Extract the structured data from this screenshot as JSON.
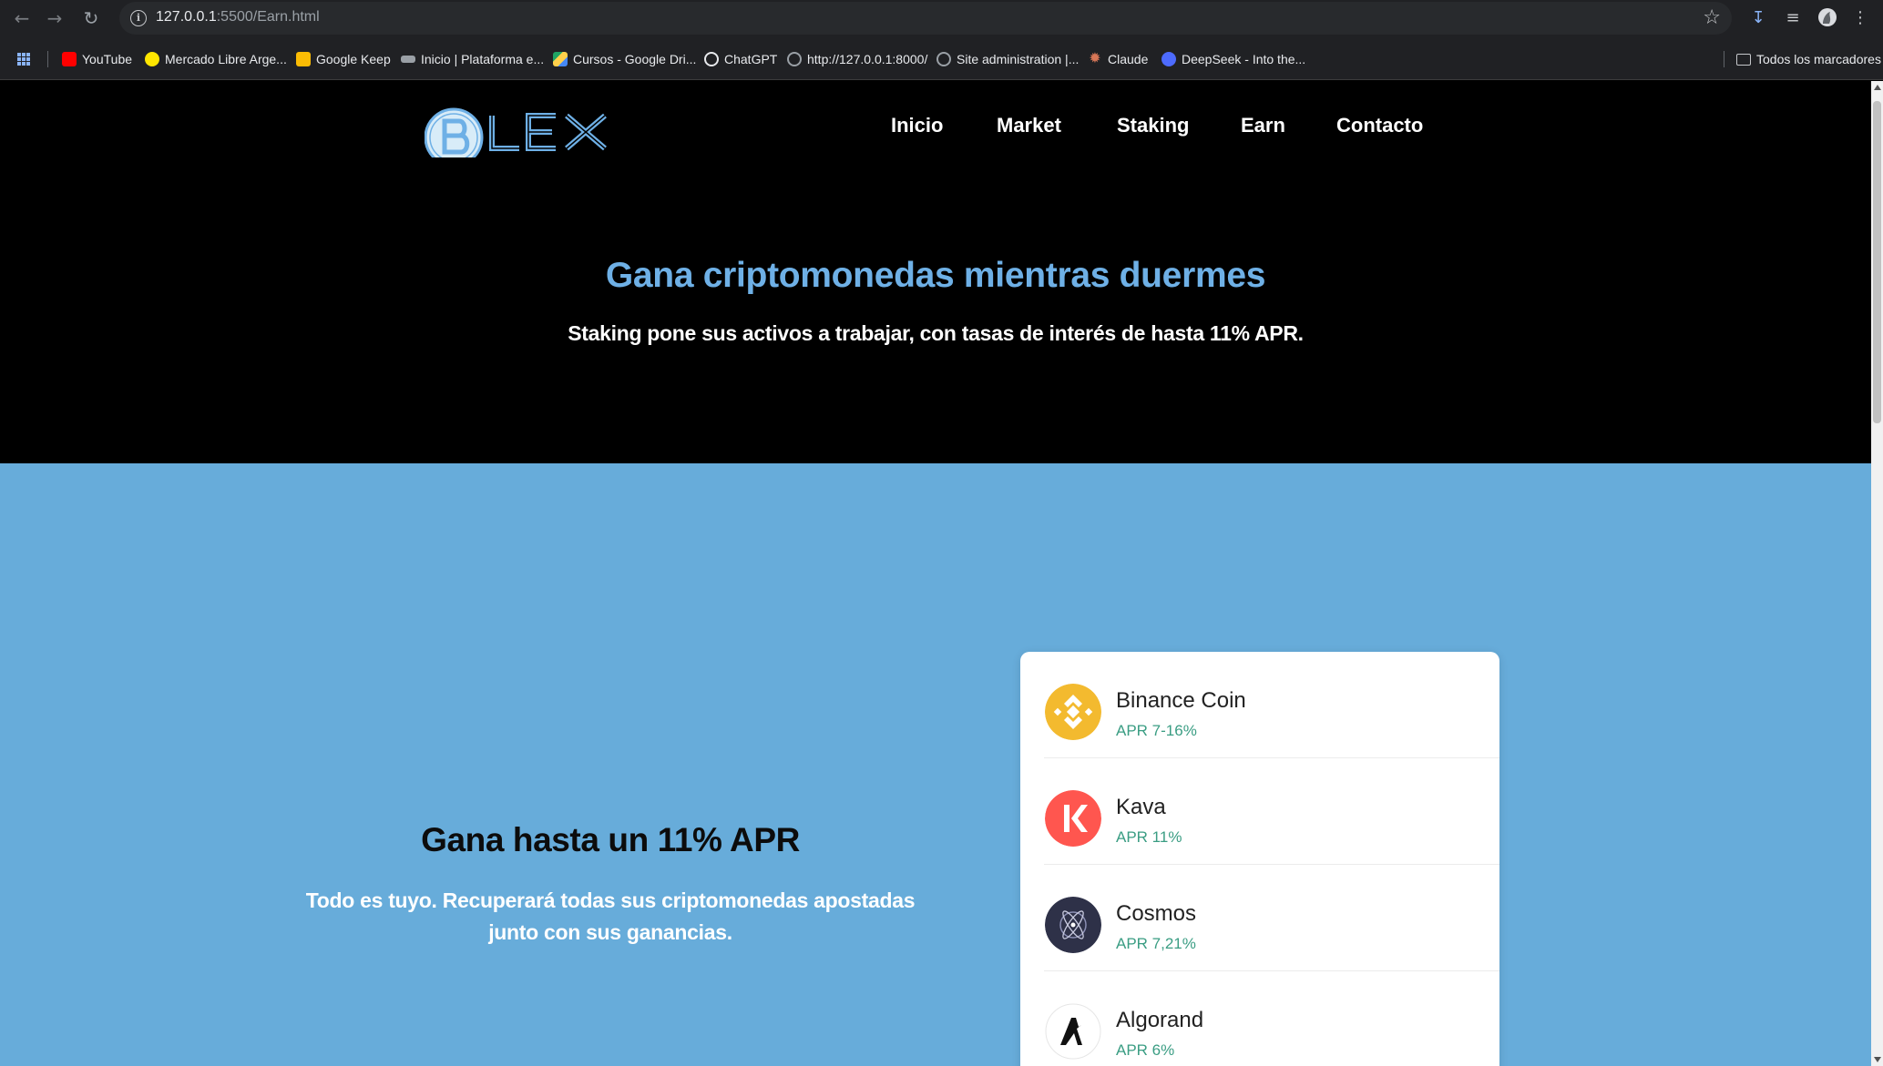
{
  "browser": {
    "url_host": "127.0.0.1",
    "url_rest": ":5500/Earn.html",
    "bookmarks": [
      {
        "label": "YouTube",
        "color": "#ff0000"
      },
      {
        "label": "Mercado Libre Arge...",
        "color": "#ffe600"
      },
      {
        "label": "Google Keep",
        "color": "#fbbc04"
      },
      {
        "label": "Inicio | Plataforma e...",
        "color": "#9aa0a6"
      },
      {
        "label": "Cursos - Google Dri...",
        "color": "#1fa463"
      },
      {
        "label": "ChatGPT",
        "color": "#e8eaed"
      },
      {
        "label": "http://127.0.0.1:8000/",
        "color": "#9aa0a6"
      },
      {
        "label": "Site administration |...",
        "color": "#9aa0a6"
      },
      {
        "label": "Claude",
        "color": "#d97757"
      },
      {
        "label": "DeepSeek - Into the...",
        "color": "#4d6bfe"
      }
    ],
    "all_bookmarks": "Todos los marcadores"
  },
  "nav": {
    "items": [
      "Inicio",
      "Market",
      "Staking",
      "Earn",
      "Contacto"
    ]
  },
  "logo": {
    "text": "BLEX",
    "color": "#6eb0e6"
  },
  "hero": {
    "title": "Gana criptomonedas mientras duermes",
    "subtitle": "Staking pone sus activos a trabajar, con tasas de interés de hasta 11% APR."
  },
  "section": {
    "title": "Gana hasta un 11% APR",
    "text": "Todo es tuyo. Recuperará todas sus criptomonedas apostadas junto con sus ganancias."
  },
  "coins": [
    {
      "name": "Binance Coin",
      "apr": "APR 7-16%",
      "icon": "binance-icon",
      "color": "#f3ba2f"
    },
    {
      "name": "Kava",
      "apr": "APR 11%",
      "icon": "kava-icon",
      "color": "#ff564f"
    },
    {
      "name": "Cosmos",
      "apr": "APR 7,21%",
      "icon": "cosmos-icon",
      "color": "#2e3148"
    },
    {
      "name": "Algorand",
      "apr": "APR 6%",
      "icon": "algorand-icon",
      "color": "#ffffff"
    }
  ],
  "colors": {
    "accent": "#6eb0e6",
    "section_bg": "#67acda",
    "apr_green": "#3a9d83"
  }
}
